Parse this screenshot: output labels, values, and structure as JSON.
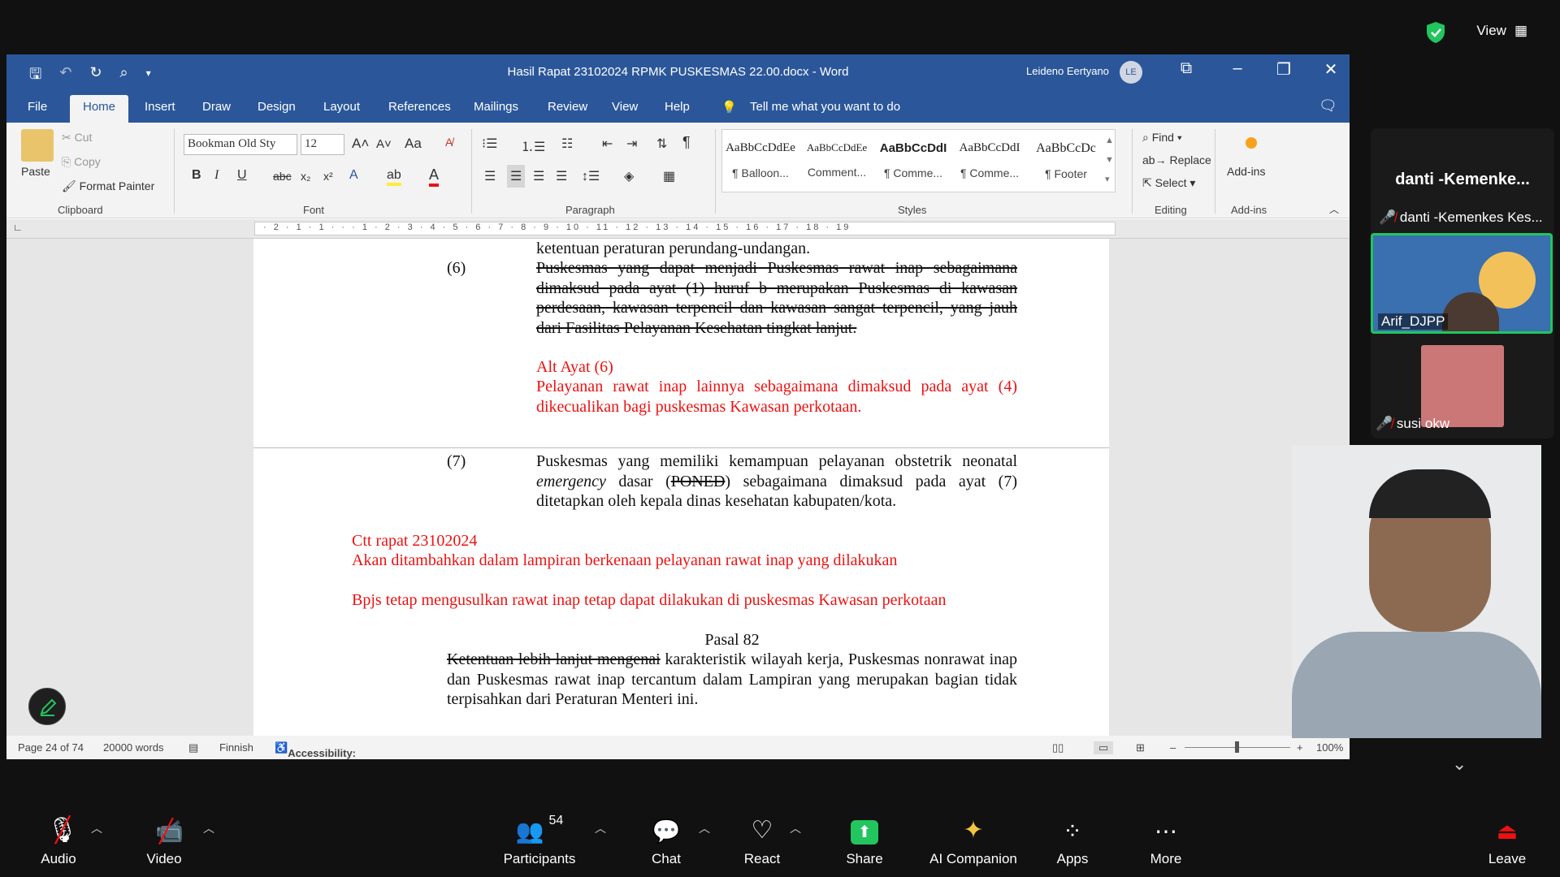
{
  "zoom_top": {
    "view_label": "View"
  },
  "word": {
    "title": "Hasil Rapat 23102024 RPMK PUSKESMAS 22.00.docx  -  Word",
    "user_name": "Leideno Eertyano",
    "user_initials": "LE",
    "menu": [
      "File",
      "Home",
      "Insert",
      "Draw",
      "Design",
      "Layout",
      "References",
      "Mailings",
      "Review",
      "View",
      "Help"
    ],
    "tell_me": "Tell me what you want to do",
    "clipboard": {
      "paste": "Paste",
      "cut": "Cut",
      "copy": "Copy",
      "format_painter": "Format Painter",
      "label": "Clipboard"
    },
    "font": {
      "name": "Bookman Old Sty",
      "size": "12",
      "label": "Font",
      "case": "Aa"
    },
    "paragraph": {
      "label": "Paragraph"
    },
    "styles": {
      "label": "Styles",
      "items": [
        {
          "preview": "AaBbCcDdEe",
          "name": "¶ Balloon..."
        },
        {
          "preview": "AaBbCcDdEe",
          "name": "Comment..."
        },
        {
          "preview": "AaBbCcDdI",
          "name": "¶ Comme..."
        },
        {
          "preview": "AaBbCcDdI",
          "name": "¶ Comme..."
        },
        {
          "preview": "AaBbCcDc",
          "name": "¶ Footer"
        }
      ]
    },
    "editing": {
      "find": "Find",
      "replace": "Replace",
      "select": "Select",
      "label": "Editing"
    },
    "addins": {
      "button": "Add-ins",
      "label": "Add-ins"
    },
    "ruler_text": "· 2 · 1 · 1 · · · 1 · 2 · 3 · 4 · 5 · 6 · 7 · 8 · 9 · 10 · 11 · 12 · 13 · 14 · 15 · 16 · 17 · 18 · 19",
    "doc": {
      "line0": "ketentuan peraturan perundang-undangan.",
      "p6_num": "(6)",
      "p6_strike": "Puskesmas yang dapat menjadi Puskesmas rawat inap sebagaimana dimaksud pada ayat (1) huruf b merupakan Puskesmas di kawasan perdesaan, kawasan terpencil dan kawasan sangat terpencil, yang jauh dari Fasilitas Pelayanan Kesehatan tingkat lanjut.",
      "alt_title": "Alt Ayat (6)",
      "alt_body": "Pelayanan rawat inap lainnya sebagaimana dimaksud pada ayat (4) dikecualikan bagi puskesmas Kawasan perkotaan.",
      "p7_num": "(7)",
      "p7_a": "Puskesmas yang memiliki kemampuan pelayanan obstetrik neonatal ",
      "p7_em": "emergency",
      "p7_b": " dasar (",
      "p7_strike": "PONED",
      "p7_c": ") sebagaimana dimaksud pada ayat (7) ditetapkan oleh kepala dinas kesehatan kabupaten/kota.",
      "note_title": "Ctt rapat 23102024",
      "note1": "Akan ditambahkan dalam lampiran berkenaan pelayanan rawat inap yang dilakukan",
      "note2": "Bpjs tetap mengusulkan rawat inap tetap dapat dilakukan di puskesmas Kawasan perkotaan",
      "pasal": "Pasal 82",
      "p82_strike": "Ketentuan lebih lanjut mengenai",
      "p82_rest": " karakteristik wilayah kerja, Puskesmas nonrawat inap dan Puskesmas rawat inap tercantum dalam Lampiran yang merupakan bagian tidak terpisahkan dari Peraturan Menteri ini."
    },
    "status": {
      "page": "Page 24 of 74",
      "words": "20000 words",
      "lang": "Finnish",
      "accessibility": "Accessibility: Investigate",
      "zoom": "100%"
    }
  },
  "panel": {
    "title": "danti -Kemenke...",
    "p1": "danti -Kemenkes Kes...",
    "p2": "Arif_DJPP",
    "p3": "susi okw"
  },
  "zoombar": {
    "audio": "Audio",
    "video": "Video",
    "participants": "Participants",
    "participants_count": "54",
    "chat": "Chat",
    "react": "React",
    "share": "Share",
    "ai": "AI Companion",
    "apps": "Apps",
    "more": "More",
    "leave": "Leave"
  }
}
